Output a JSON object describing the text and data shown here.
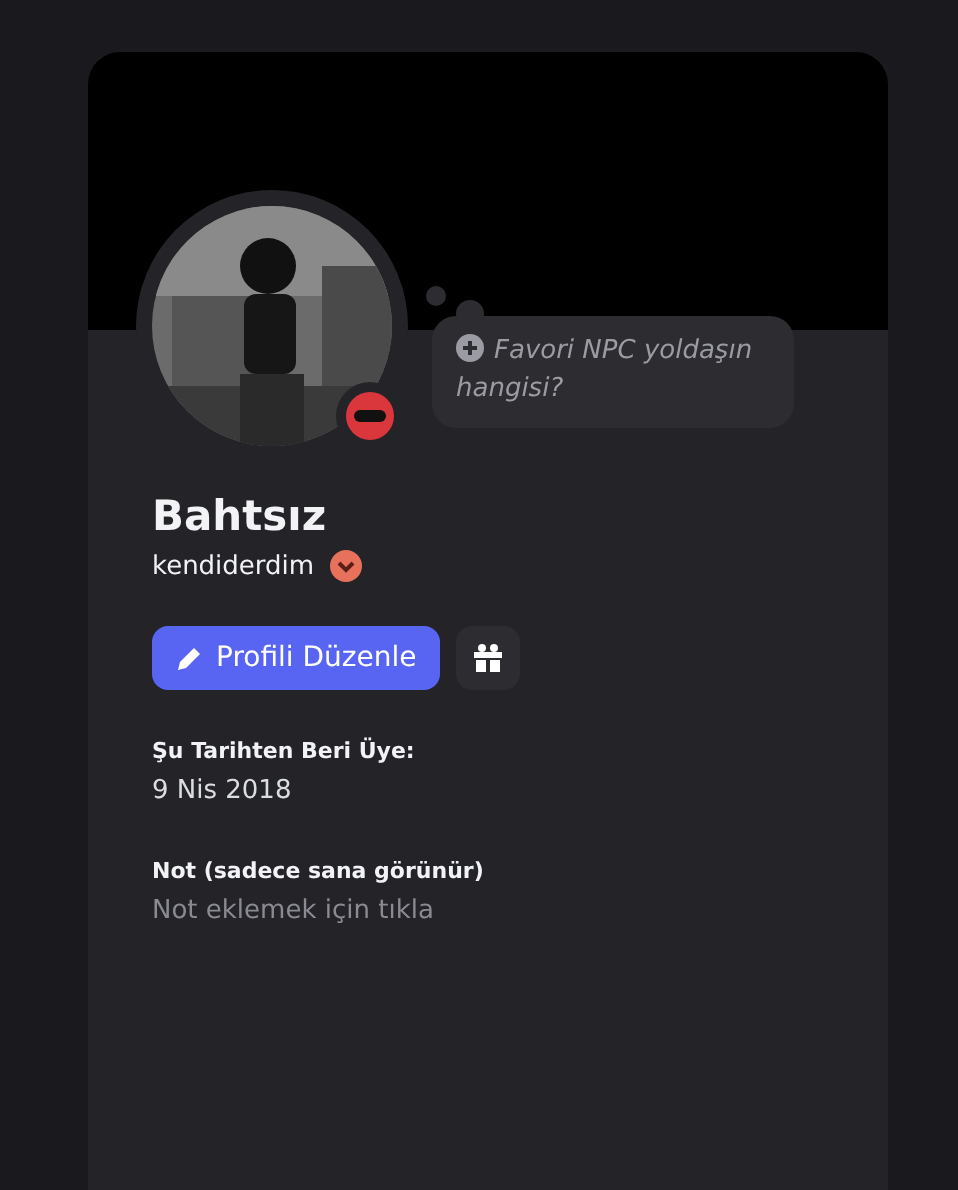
{
  "profile": {
    "display_name": "Bahtsız",
    "username": "kendiderdim",
    "do_not_disturb": true,
    "custom_status": {
      "placeholder": "Favori NPC yoldaşın hangisi?"
    },
    "edit_button": {
      "label": "Profili Düzenle"
    },
    "member_since": {
      "label": "Şu Tarihten Beri Üye:",
      "value": "9 Nis 2018"
    },
    "note": {
      "label": "Not (sadece sana görünür)",
      "placeholder": "Not eklemek için tıkla"
    }
  }
}
